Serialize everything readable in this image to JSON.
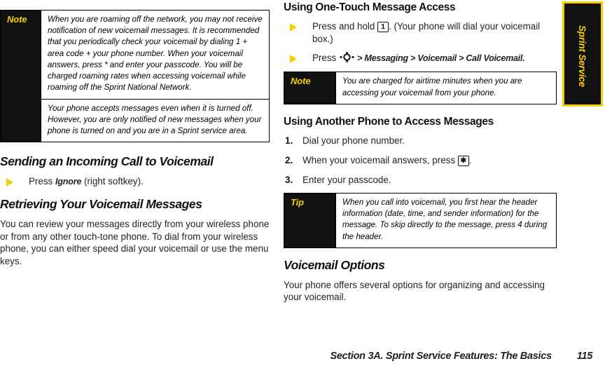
{
  "document": {
    "footer": {
      "section_title": "Section 3A. Sprint Service Features: The Basics",
      "page_number": "115"
    },
    "section_tab": {
      "label": "Sprint Service"
    }
  },
  "left_column": {
    "note_box": {
      "label": "Note",
      "paragraphs": [
        "When you are roaming off the network, you may not receive notification of new voicemail messages. It is recommended that you periodically check your voicemail by dialing 1 + area code + your phone number. When your voicemail answers, press * and enter your passcode. You will be charged roaming rates when accessing voicemail while roaming off the Sprint National Network.",
        "Your phone accepts messages even when it is turned off. However, you are only notified of new messages when your phone is turned on and you are in a Sprint service area."
      ]
    },
    "heading_sending": "Sending an Incoming Call to Voicemail",
    "bullet_ignore": {
      "prefix": "Press ",
      "emphasis": "Ignore",
      "suffix": " (right softkey)."
    },
    "heading_retrieving": "Retrieving Your Voicemail Messages",
    "retrieving_paragraph": "You can review your messages directly from your wireless phone or from any other touch-tone phone. To dial from your wireless phone, you can either speed dial your voicemail or use the menu keys."
  },
  "right_column": {
    "heading_one_touch": "Using One-Touch Message Access",
    "bullet_press_hold": {
      "prefix": "Press and hold ",
      "key": "1",
      "suffix": ". (Your phone will dial your voicemail box.)"
    },
    "bullet_menu_path": {
      "prefix": "Press ",
      "nav_key": "navigation-key",
      "separator_1": " > ",
      "item_1": "Messaging",
      "separator_2": " > ",
      "item_2": "Voicemail",
      "separator_3": " > ",
      "item_3": "Call Voicemail."
    },
    "note_box": {
      "label": "Note",
      "text": "You are charged for airtime minutes when you are accessing your voicemail from your phone."
    },
    "heading_another_phone": "Using Another Phone to Access Messages",
    "steps": [
      {
        "num": "1.",
        "prefix": "Dial your phone number.",
        "key": "",
        "suffix": ""
      },
      {
        "num": "2.",
        "prefix": "When your voicemail answers, press ",
        "key": "✱",
        "suffix": "."
      },
      {
        "num": "3.",
        "prefix": "Enter your passcode.",
        "key": "",
        "suffix": ""
      }
    ],
    "tip_box": {
      "label": "Tip",
      "text": "When you call into voicemail, you first hear the header information (date, time, and sender information) for the message. To skip directly to the message, press 4 during the header."
    },
    "heading_voicemail_options": "Voicemail Options",
    "voicemail_options_paragraph": "Your phone offers several options for organizing and accessing your voicemail."
  }
}
